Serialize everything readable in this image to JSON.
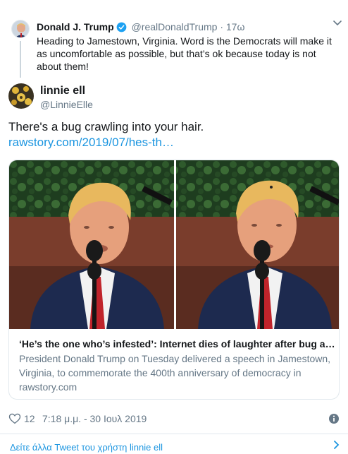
{
  "reply": {
    "name": "Donald J. Trump",
    "handle": "@realDonaldTrump",
    "separator": "·",
    "time": "17ω",
    "text": "Heading to Jamestown, Virginia. Word is the Democrats will make it as uncomfortable as possible, but that’s ok because today is not about them!"
  },
  "tweet": {
    "name": "linnie ell",
    "handle": "@LinnieElle",
    "text": "There's a bug crawling into your hair. ",
    "link_text": "rawstory.com/2019/07/hes-th…"
  },
  "card": {
    "title": "‘He’s the one who’s infested’: Internet dies of laughter after bug a…",
    "description": "President Donald Trump on Tuesday delivered a speech in Jamestown, Virginia, to commemorate the 400th anniversary of democracy in",
    "domain": "rawstory.com"
  },
  "footer": {
    "likes": "12",
    "timestamp": "7:18 μ.μ. - 30 Ιουλ 2019"
  },
  "more": {
    "label": "Δείτε άλλα Tweet του χρήστη linnie ell"
  },
  "icons": {
    "verified": "verified-badge-icon",
    "like": "heart-icon",
    "info": "info-icon",
    "chevron": "chevron-down-icon",
    "more_arrow": "chevron-right-icon"
  },
  "colors": {
    "link": "#1b95e0",
    "secondary_text": "#657786",
    "primary_text": "#14171a",
    "border": "#e1e8ed"
  }
}
